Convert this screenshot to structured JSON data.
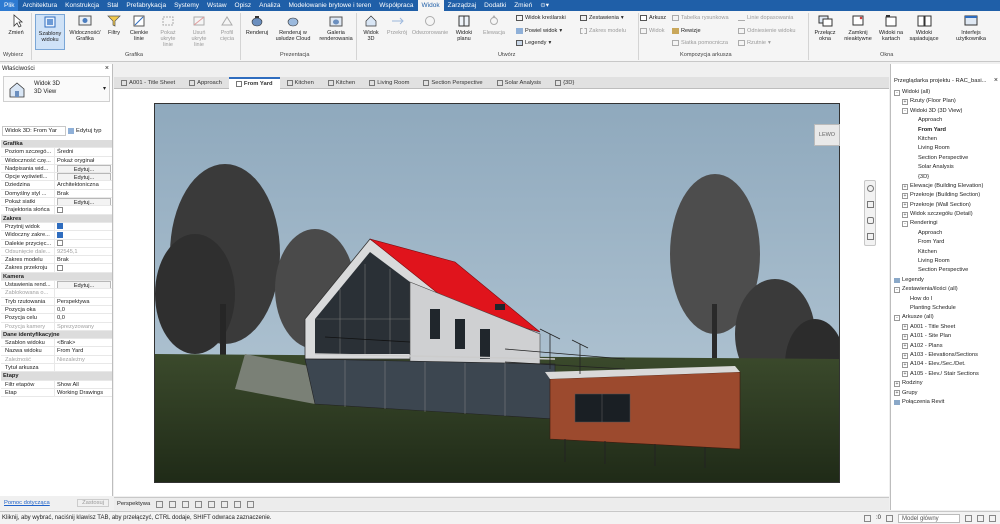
{
  "ribbon_tabs": [
    "Plik",
    "Architektura",
    "Konstrukcja",
    "Stal",
    "Prefabrykacja",
    "Systemy",
    "Wstaw",
    "Opisz",
    "Analiza",
    "Modelowanie brytowe i teren",
    "Współpraca",
    "Widok",
    "Zarządzaj",
    "Dodatki",
    "Zmień"
  ],
  "active_tab": "Widok",
  "ribbon": {
    "wybierz": {
      "zmien": "Zmień",
      "group": "Wybierz"
    },
    "grafika": {
      "szablony": "Szablony widoku",
      "widocznosc": "Widoczność/ Grafika",
      "filtry": "Filtry",
      "cienkie": "Cienkie linie",
      "pokaz_ukryte": "Pokaż ukryte linie",
      "usun_ukryte": "Usuń ukryte linie",
      "profil": "Profil cięcia",
      "group": "Grafika"
    },
    "prezentacja": {
      "renderuj": "Renderuj",
      "cloud": "Renderuj w usłudze Cloud",
      "galeria": "Galeria renderowania",
      "group": "Prezentacja"
    },
    "utworz": {
      "widok3d": "Widok 3D",
      "przekroj": "Przekrój",
      "odwzorowanie": "Odwzorowanie",
      "widoki_planu": "Widoki planu",
      "elewacja": "Elewacja",
      "widok_kreslarski": "Widok kreślarski",
      "powiel": "Powiel widok",
      "legendy": "Legendy",
      "zestawienia": "Zestawienia",
      "zakres": "Zakres modelu",
      "group": "Utwórz"
    },
    "arkusz": {
      "arkusz": "Arkusz",
      "widok": "Widok",
      "tabelka": "Tabelka rysunkowa",
      "rewizje": "Rewizje",
      "siatka": "Siatka pomocnicza",
      "linie": "Linie dopasowania",
      "odniesienie": "Odniesienie widoku",
      "rzutnie": "Rzutnie",
      "group": "Kompozycja arkusza"
    },
    "okna": {
      "przelacz": "Przełącz okna",
      "zamknij": "Zamknij nieaktywne",
      "widoki_kart": "Widoki na kartach",
      "widoki_sas": "Widoki sąsiadujące",
      "interfejs": "Interfejs użytkownika",
      "group": "Okna"
    }
  },
  "properties": {
    "title": "Właściwości",
    "type_name": "Widok 3D",
    "type_sub": "3D View",
    "selector": "Widok 3D: From Yar",
    "edit_type": "Edytuj typ",
    "rows": [
      {
        "g": "Grafika"
      },
      {
        "l": "Poziom szczegó...",
        "v": "Średni"
      },
      {
        "l": "Widoczność czę...",
        "v": "Pokaż oryginał"
      },
      {
        "l": "Nadpisania wid...",
        "v": "Edytuj..."
      },
      {
        "l": "Opcje wyświetl...",
        "v": "Edytuj..."
      },
      {
        "l": "Dziedzina",
        "v": "Architektoniczna"
      },
      {
        "l": "Domyślny styl ...",
        "v": "Brak"
      },
      {
        "l": "Pokaż siatki",
        "v": "Edytuj..."
      },
      {
        "l": "Trajektoria słońca",
        "v": "",
        "c": false
      },
      {
        "g": "Zakres"
      },
      {
        "l": "Przytnij widok",
        "v": "",
        "c": true
      },
      {
        "l": "Widoczny zakre...",
        "v": "",
        "c": true
      },
      {
        "l": "Dalekie przycięc...",
        "v": "",
        "c": false
      },
      {
        "l": "Odsunięcie dale...",
        "v": "92545,1",
        "d": true
      },
      {
        "l": "Zakres modelu",
        "v": "Brak"
      },
      {
        "l": "Zakres przekroju",
        "v": "",
        "c": false
      },
      {
        "g": "Kamera"
      },
      {
        "l": "Ustawienia rend...",
        "v": "Edytuj..."
      },
      {
        "l": "Zablokowana o...",
        "v": "",
        "d": true
      },
      {
        "l": "Tryb rzutowania",
        "v": "Perspektywa"
      },
      {
        "l": "Pozycja oka",
        "v": "0,0"
      },
      {
        "l": "Pozycja celu",
        "v": "0,0"
      },
      {
        "l": "Pozycja kamery",
        "v": "Sprezyzowany",
        "d": true
      },
      {
        "g": "Dane identyfikacyjne"
      },
      {
        "l": "Szablon widoku",
        "v": "<Brak>"
      },
      {
        "l": "Nazwa widoku",
        "v": "From Yard"
      },
      {
        "l": "Zależność",
        "v": "Niezależny",
        "d": true
      },
      {
        "l": "Tytuł arkusza",
        "v": ""
      },
      {
        "g": "Etapy"
      },
      {
        "l": "Filtr etapów",
        "v": "Show All"
      },
      {
        "l": "Etap",
        "v": "Working Drawings"
      }
    ],
    "help_link": "Pomoc dotycząca",
    "apply": "Zastosuj"
  },
  "view_tabs": [
    "A001 - Title Sheet",
    "Approach",
    "From Yard",
    "Kitchen",
    "Kitchen",
    "Living Room",
    "Section Perspective",
    "Solar Analysis",
    "{3D}"
  ],
  "active_view_tab": "From Yard",
  "viewcube_text": "LEWO",
  "view_status": {
    "mode": "Perspektywa"
  },
  "browser": {
    "title": "Przeglądarka projektu - RAC_basi...",
    "nodes": [
      {
        "t": "Widoki (all)",
        "lvl": 0,
        "e": "-"
      },
      {
        "t": "Rzuty (Floor Plan)",
        "lvl": 1,
        "e": "+"
      },
      {
        "t": "Widoki 3D (3D View)",
        "lvl": 1,
        "e": "-"
      },
      {
        "t": "Approach",
        "lvl": 3
      },
      {
        "t": "From Yard",
        "lvl": 3,
        "b": true
      },
      {
        "t": "Kitchen",
        "lvl": 3
      },
      {
        "t": "Living Room",
        "lvl": 3
      },
      {
        "t": "Section Perspective",
        "lvl": 3
      },
      {
        "t": "Solar Analysis",
        "lvl": 3
      },
      {
        "t": "{3D}",
        "lvl": 3
      },
      {
        "t": "Elewacje (Building Elevation)",
        "lvl": 1,
        "e": "+"
      },
      {
        "t": "Przekroje (Building Section)",
        "lvl": 1,
        "e": "+"
      },
      {
        "t": "Przekroje (Wall Section)",
        "lvl": 1,
        "e": "+"
      },
      {
        "t": "Widok szczegółu (Detail)",
        "lvl": 1,
        "e": "+"
      },
      {
        "t": "Renderingi",
        "lvl": 1,
        "e": "-"
      },
      {
        "t": "Approach",
        "lvl": 3
      },
      {
        "t": "From Yard",
        "lvl": 3
      },
      {
        "t": "Kitchen",
        "lvl": 3
      },
      {
        "t": "Living Room",
        "lvl": 3
      },
      {
        "t": "Section Perspective",
        "lvl": 3
      },
      {
        "t": "Legendy",
        "lvl": 0,
        "i": true
      },
      {
        "t": "Zestawienia/ilości (all)",
        "lvl": 0,
        "e": "-"
      },
      {
        "t": "How do I",
        "lvl": 2
      },
      {
        "t": "Planting Schedule",
        "lvl": 2
      },
      {
        "t": "Arkusze (all)",
        "lvl": 0,
        "e": "-"
      },
      {
        "t": "A001 - Title Sheet",
        "lvl": 1,
        "e": "+"
      },
      {
        "t": "A101 - Site Plan",
        "lvl": 1,
        "e": "+"
      },
      {
        "t": "A102 - Plans",
        "lvl": 1,
        "e": "+"
      },
      {
        "t": "A103 - Elevations/Sections",
        "lvl": 1,
        "e": "+"
      },
      {
        "t": "A104 - Elev./Sec./Det.",
        "lvl": 1,
        "e": "+"
      },
      {
        "t": "A105 - Elev./ Stair Sections",
        "lvl": 1,
        "e": "+"
      },
      {
        "t": "Rodziny",
        "lvl": 0,
        "e": "+"
      },
      {
        "t": "Grupy",
        "lvl": 0,
        "e": "+"
      },
      {
        "t": "Połączenia Revit",
        "lvl": 0,
        "i": true
      }
    ]
  },
  "statusbar": {
    "message": "Kliknij, aby wybrać, naciśnij klawisz TAB, aby przełączyć, CTRL dodaje, SHIFT odwraca zaznaczenie.",
    "model_field": "Model główny",
    "workset_value": ":0"
  },
  "colors": {
    "ribbon_blue": "#1f5fa8",
    "roof_red": "#e0141c",
    "cladding": "#9c4a2e",
    "sky": "#9fb6c8"
  }
}
